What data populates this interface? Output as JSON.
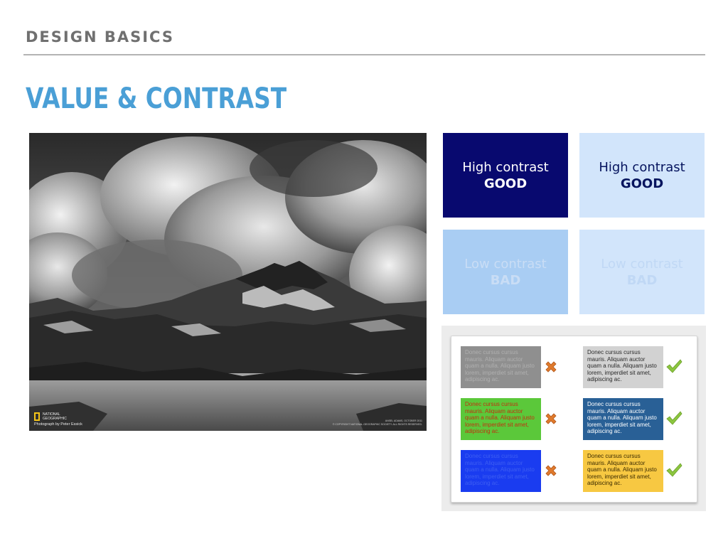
{
  "header": {
    "section": "DESIGN BASICS",
    "title": "VALUE & CONTRAST"
  },
  "photo": {
    "alt": "Black and white photograph of mountains and lake under storm clouds",
    "brand_line1": "NATIONAL",
    "brand_line2": "GEOGRAPHIC",
    "credit": "Photograph by Peter Essick",
    "caption_line1": "ANSEL ADAMS, OCTOBER 2011",
    "caption_line2": "© COPYRIGHT NATIONAL GEOGRAPHIC SOCIETY. ALL RIGHTS RESERVED."
  },
  "tiles": [
    {
      "line1": "High contrast",
      "line2": "GOOD",
      "bg": "#08096f",
      "fg": "#ffffff"
    },
    {
      "line1": "High contrast",
      "line2": "GOOD",
      "bg": "#d2e5fb",
      "fg": "#06145e"
    },
    {
      "line1": "Low contrast",
      "line2": "BAD",
      "bg": "#a9cdf3",
      "fg": "#c9ddf5"
    },
    {
      "line1": "Low contrast",
      "line2": "BAD",
      "bg": "#d2e5fb",
      "fg": "#c0d8f5"
    }
  ],
  "examples": {
    "text": "Donec cursus cursus mauris. Aliquam auctor quam a nulla. Aliquam justo lorem, imperdiet sit amet, adipiscing ac.",
    "rows": [
      {
        "bad": {
          "bg": "#8f8f8f",
          "fg": "#b0b0b0",
          "mark": "cross-icon"
        },
        "good": {
          "bg": "#d2d2d2",
          "fg": "#2a2a2a",
          "mark": "check-icon"
        }
      },
      {
        "bad": {
          "bg": "#5bc83a",
          "fg": "#c23010",
          "mark": "cross-icon"
        },
        "good": {
          "bg": "#296096",
          "fg": "#ffffff",
          "mark": "check-icon"
        }
      },
      {
        "bad": {
          "bg": "#1a3cf0",
          "fg": "#3e5ff2",
          "mark": "cross-icon"
        },
        "good": {
          "bg": "#f7c842",
          "fg": "#3a2a00",
          "mark": "check-icon"
        }
      }
    ],
    "cross_color": "#e07a2c",
    "check_color": "#8cc63f"
  }
}
